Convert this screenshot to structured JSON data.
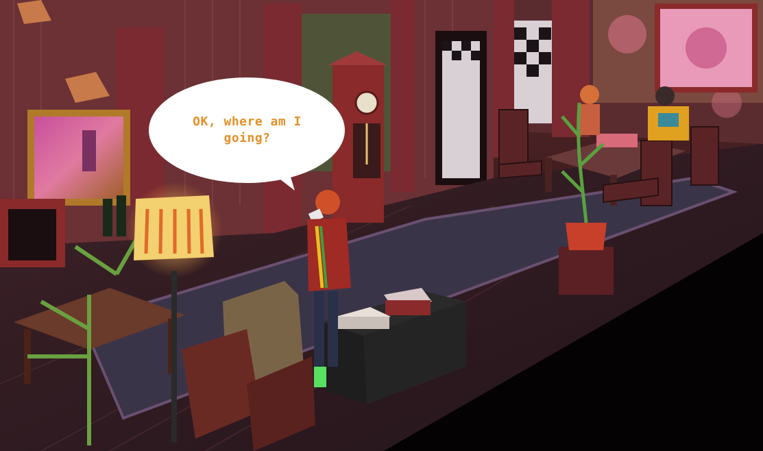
{
  "dialogue": {
    "text": "OK, where am I going?"
  }
}
